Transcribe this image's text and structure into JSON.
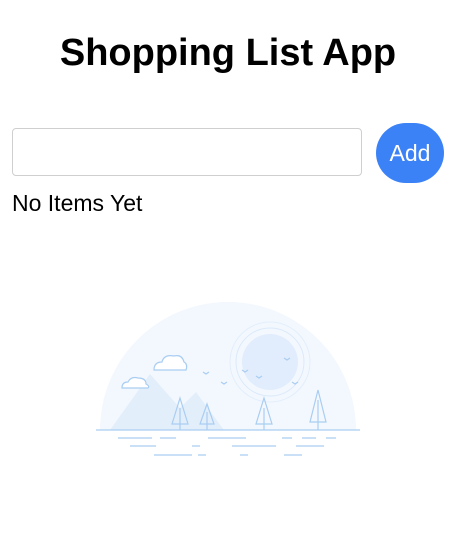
{
  "header": {
    "title": "Shopping List App"
  },
  "form": {
    "input_value": "",
    "input_placeholder": "",
    "add_label": "Add"
  },
  "list": {
    "empty_message": "No Items Yet"
  },
  "colors": {
    "accent": "#3b82f6",
    "illustration_line": "#a9cdf2",
    "illustration_fill": "#f1f7fe"
  },
  "icons": {
    "empty_state": "empty-landscape-illustration-icon"
  }
}
